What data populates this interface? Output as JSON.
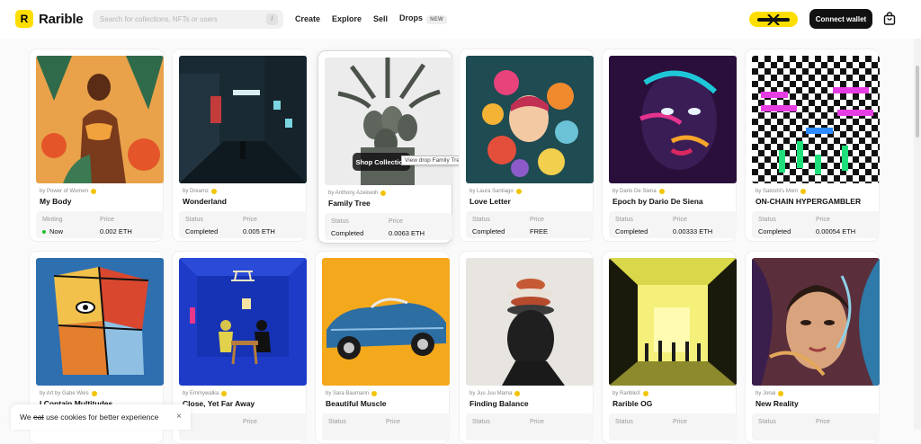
{
  "brand": {
    "name": "Rarible",
    "logo_mark": "R"
  },
  "search": {
    "placeholder": "Search for collections, NFTs or users",
    "shortcut": "/"
  },
  "nav": [
    {
      "label": "Create"
    },
    {
      "label": "Explore"
    },
    {
      "label": "Sell"
    },
    {
      "label": "Drops",
      "badge": "NEW"
    }
  ],
  "header_actions": {
    "connect_label": "Connect wallet",
    "promo_icon": "x-logo-icon",
    "cart_icon": "bag-icon"
  },
  "overlay": {
    "button_label": "Shop Collection",
    "tooltip": "View drop Family Tree"
  },
  "cards": [
    {
      "creator": "by Power of Women",
      "title": "My Body",
      "status_label": "Minting",
      "status_value": "Now",
      "live": true,
      "price_label": "Price",
      "price_value": "0.002 ETH"
    },
    {
      "creator": "by Dreamz",
      "title": "Wonderland",
      "status_label": "Status",
      "status_value": "Completed",
      "price_label": "Price",
      "price_value": "0.005 ETH"
    },
    {
      "creator": "by Anthony Azekwoh",
      "title": "Family Tree",
      "status_label": "Status",
      "status_value": "Completed",
      "price_label": "Price",
      "price_value": "0.0063 ETH"
    },
    {
      "creator": "by Laura Santiago",
      "title": "Love Letter",
      "status_label": "Status",
      "status_value": "Completed",
      "price_label": "Price",
      "price_value": "FREE"
    },
    {
      "creator": "by Dario De Siena",
      "title": "Epoch by Dario De Siena",
      "status_label": "Status",
      "status_value": "Completed",
      "price_label": "Price",
      "price_value": "0.00333 ETH"
    },
    {
      "creator": "by Satoshi's Mom",
      "title": "ON-CHAIN HYPERGAMBLER",
      "status_label": "Status",
      "status_value": "Completed",
      "price_label": "Price",
      "price_value": "0.00054 ETH"
    },
    {
      "creator": "by Art by Gabe Weis",
      "title": "I Contain Multitudes",
      "status_label": "",
      "status_value": "",
      "price_label": "",
      "price_value": ""
    },
    {
      "creator": "by Emmywalka",
      "title": "Close, Yet Far Away",
      "status_label": "",
      "status_value": "",
      "price_label": "Price",
      "price_value": ""
    },
    {
      "creator": "by Sara Baumann",
      "title": "Beautiful Muscle",
      "status_label": "Status",
      "status_value": "",
      "price_label": "Price",
      "price_value": ""
    },
    {
      "creator": "by Juu Juu Mama",
      "title": "Finding Balance",
      "status_label": "Status",
      "status_value": "",
      "price_label": "Price",
      "price_value": ""
    },
    {
      "creator": "by RaribleX",
      "title": "Rarible OG",
      "status_label": "Status",
      "status_value": "",
      "price_label": "Price",
      "price_value": ""
    },
    {
      "creator": "by Jonai",
      "title": "New Reality",
      "status_label": "Status",
      "status_value": "",
      "price_label": "Price",
      "price_value": ""
    }
  ],
  "cookie": {
    "prefix": "We ",
    "struck": "eat",
    "suffix": " use cookies for better experience",
    "close": "×"
  },
  "colors": {
    "brand_yellow": "#fede00",
    "button_dark": "#111111",
    "live_green": "#21c12c"
  }
}
